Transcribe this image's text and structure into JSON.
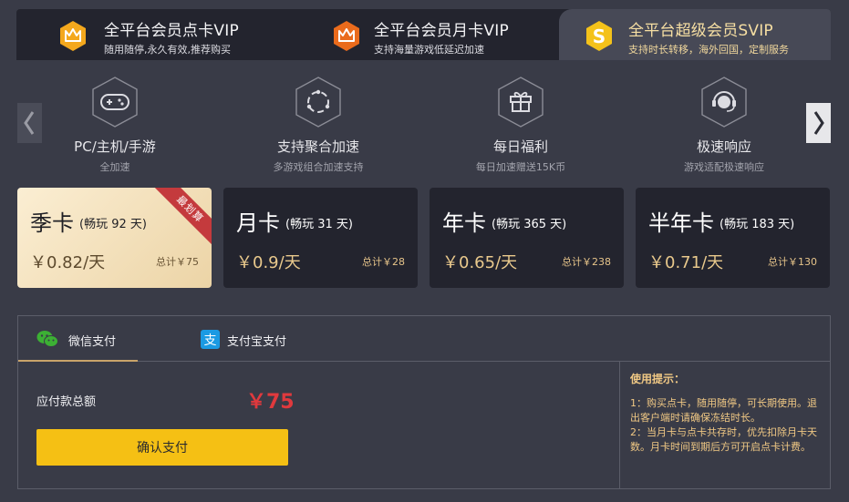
{
  "tabs": [
    {
      "title": "全平台会员点卡VIP",
      "subtitle": "随用随停,永久有效,推荐购买",
      "icon": "crown-icon",
      "badge_color": "#f4a81d"
    },
    {
      "title": "全平台会员月卡VIP",
      "subtitle": "支持海量游戏低延迟加速",
      "icon": "crown-icon",
      "badge_color": "#ea6b1c"
    },
    {
      "title": "全平台超级会员SVIP",
      "subtitle": "支持时长转移，海外回国，定制服务",
      "icon": "dollar-icon",
      "badge_color": "#f4c21a"
    }
  ],
  "features": [
    {
      "label": "PC/主机/手游",
      "sub": "全加速",
      "icon": "gamepad-icon"
    },
    {
      "label": "支持聚合加速",
      "sub": "多游戏组合加速支持",
      "icon": "orbit-icon"
    },
    {
      "label": "每日福利",
      "sub": "每日加速赠送15K币",
      "icon": "gift-icon"
    },
    {
      "label": "极速响应",
      "sub": "游戏适配极速响应",
      "icon": "headset-icon"
    }
  ],
  "plans": [
    {
      "name": "季卡",
      "duration": "(畅玩 92 天)",
      "price_per_day": "￥0.82/天",
      "total": "总计￥75",
      "ribbon": "最划算"
    },
    {
      "name": "月卡",
      "duration": "(畅玩 31 天)",
      "price_per_day": "￥0.9/天",
      "total": "总计￥28"
    },
    {
      "name": "年卡",
      "duration": "(畅玩 365 天)",
      "price_per_day": "￥0.65/天",
      "total": "总计￥238"
    },
    {
      "name": "半年卡",
      "duration": "(畅玩 183 天)",
      "price_per_day": "￥0.71/天",
      "total": "总计￥130"
    }
  ],
  "payment": {
    "tabs": [
      {
        "label": "微信支付",
        "icon": "wechat-icon",
        "color": "#3cb034"
      },
      {
        "label": "支付宝支付",
        "icon": "alipay-icon",
        "color": "#1b9ae3"
      }
    ],
    "amount_label": "应付款总额",
    "amount": "￥75",
    "confirm_label": "确认支付"
  },
  "tips": {
    "heading": "使用提示：",
    "lines": [
      "1：购买点卡，随用随停，可长期使用。退出客户端时请确保冻结时长。",
      "2：当月卡与点卡共存时，优先扣除月卡天数。月卡时间到期后方可开启点卡计费。"
    ]
  },
  "colors": {
    "accent_gold": "#f0c884",
    "price_red": "#e0393d",
    "confirm_yellow": "#f5c014"
  }
}
